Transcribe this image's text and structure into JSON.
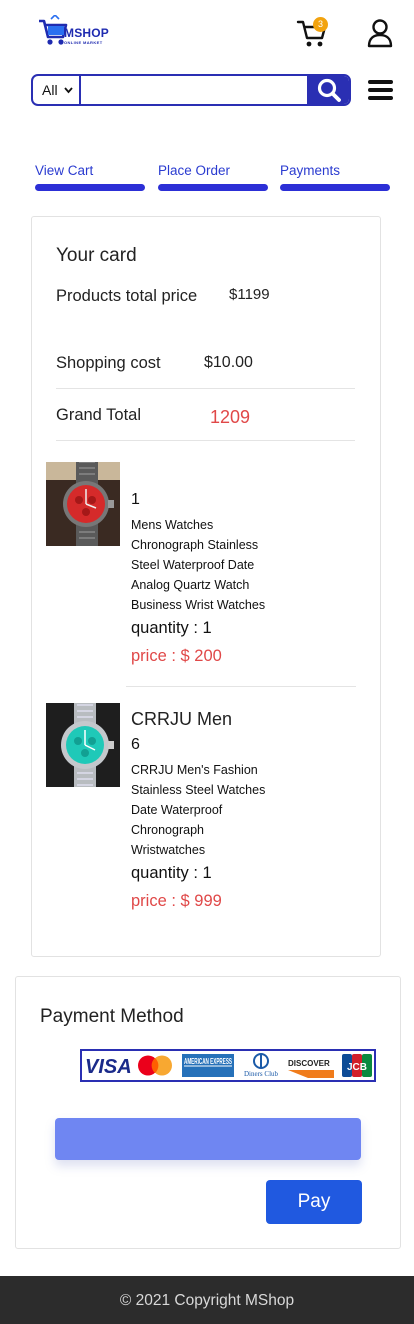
{
  "brand": {
    "name": "MSHOP",
    "tagline": "ONLINE MARKET",
    "accent": "#2a2fb3"
  },
  "header": {
    "cart_count": "3",
    "cart_icon": "cart-icon",
    "user_icon": "user-icon",
    "menu_icon": "hamburger-menu-icon"
  },
  "search": {
    "category": "All",
    "value": "",
    "placeholder": ""
  },
  "steps": [
    {
      "label": "View Cart"
    },
    {
      "label": "Place Order"
    },
    {
      "label": "Payments"
    }
  ],
  "summary": {
    "heading": "Your card",
    "products_total_label": "Products total price",
    "products_total_value": "$1199",
    "shipping_label": "Shopping cost",
    "shipping_value": "$10.00",
    "grand_total_label": "Grand Total",
    "grand_total_value": "1209"
  },
  "items": [
    {
      "title": "",
      "number": "1",
      "description": "Mens Watches Chronograph Stainless Steel Waterproof Date Analog Quartz Watch Business Wrist Watches",
      "quantity": "quantity : 1",
      "price": "price : $ 200"
    },
    {
      "title": "CRRJU Men",
      "number": "6",
      "description": "CRRJU Men's Fashion Stainless Steel Watches Date Waterproof Chronograph Wristwatches",
      "quantity": "quantity : 1",
      "price": "price : $ 999"
    }
  ],
  "payment": {
    "title": "Payment Method",
    "card_brands": [
      "VISA",
      "AMERICAN EXPRESS",
      "Diners Club",
      "DISCOVER",
      "JCB"
    ],
    "card_value": "",
    "pay_label": "Pay"
  },
  "footer": {
    "text": "© 2021 Copyright MShop"
  },
  "colors": {
    "primary": "#2a2fb3",
    "price_red": "#e04848",
    "pay_blue": "#2059e0",
    "card_field": "#6f86f2",
    "badge": "#f2a30f"
  }
}
